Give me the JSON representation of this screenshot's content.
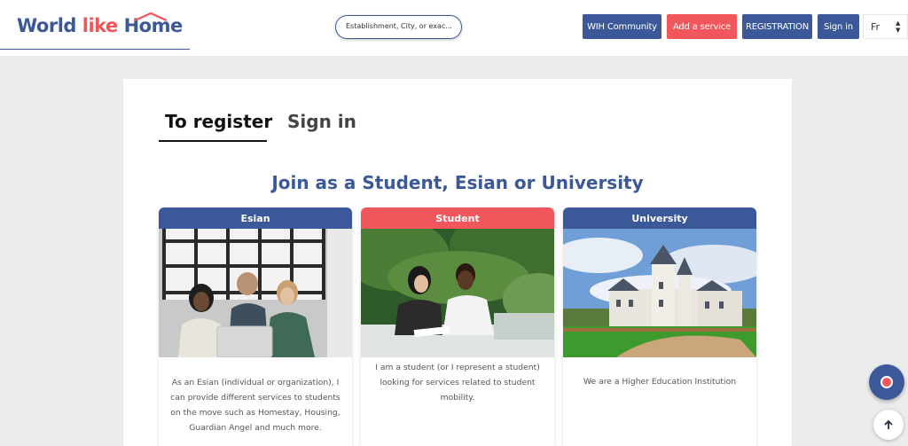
{
  "header": {
    "logo": {
      "part1": "World ",
      "part2": "like ",
      "part3": "Home"
    },
    "search": {
      "placeholder": "Establishment, City, or exac..."
    },
    "buttons": {
      "community": "WIH Community",
      "add_service": "Add a service",
      "registration": "REGISTRATION",
      "sign_in": "Sign in"
    },
    "language": "Fr"
  },
  "tabs": {
    "register": "To register",
    "sign_in": "Sign in",
    "active": "register"
  },
  "heading": "Join as a Student, Esian or University",
  "cards": [
    {
      "title": "Esian",
      "description": "As an Esian (individual or organization), I can provide different services to students on the move such as Homestay, Housing, Guardian Angel and much more."
    },
    {
      "title": "Student",
      "description": "I am a student (or I represent a student) looking for services related to student mobility."
    },
    {
      "title": "University",
      "description": "We are a Higher Education Institution"
    }
  ],
  "icons": {
    "chat": "chat-icon",
    "scroll_top": "arrow-up-icon",
    "language_select": "chevron-updown-icon"
  },
  "colors": {
    "primary": "#3b5998",
    "accent": "#f0565b",
    "background": "#ececec"
  }
}
